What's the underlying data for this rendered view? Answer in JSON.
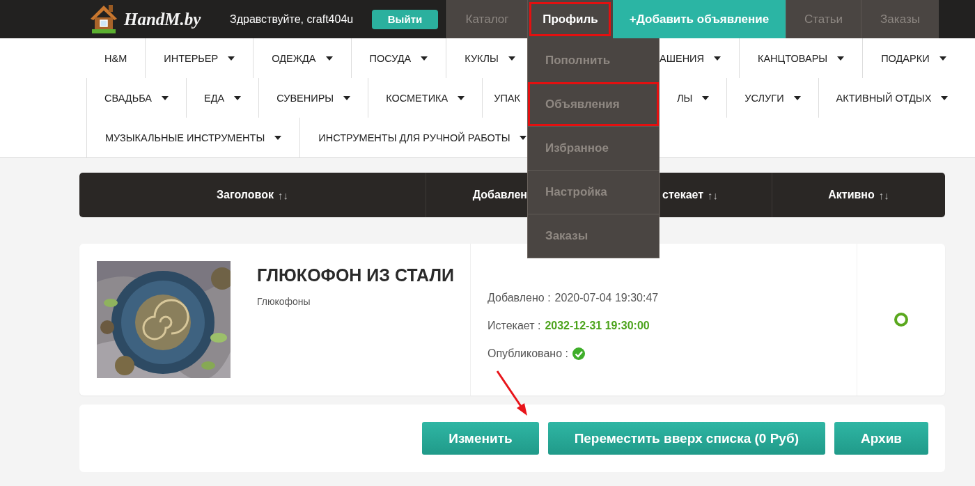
{
  "header": {
    "logo": "HandM.by",
    "greeting": "Здравствуйте, craft404u",
    "logout": "Выйти"
  },
  "nav": [
    {
      "label": "Каталог",
      "kind": "tab",
      "selected": false,
      "highlighted": false
    },
    {
      "label": "Профиль",
      "kind": "tab",
      "selected": true,
      "highlighted": true,
      "menu": [
        {
          "label": "Пополнить",
          "highlighted": false
        },
        {
          "label": "Объявления",
          "highlighted": true
        },
        {
          "label": "Избранное",
          "highlighted": false
        },
        {
          "label": "Настройка",
          "highlighted": false
        },
        {
          "label": "Заказы",
          "highlighted": false
        }
      ]
    },
    {
      "label": "+Добавить объявление",
      "kind": "accent"
    },
    {
      "label": "Статьи",
      "kind": "tab",
      "selected": false,
      "highlighted": false
    },
    {
      "label": "Заказы",
      "kind": "tab",
      "selected": false,
      "highlighted": false
    }
  ],
  "categories": [
    {
      "left": [
        {
          "label": "H&M",
          "dropdown": false
        },
        {
          "label": "ИНТЕРЬЕР",
          "dropdown": true
        },
        {
          "label": "ОДЕЖДА",
          "dropdown": true
        },
        {
          "label": "ПОСУДА",
          "dropdown": true
        },
        {
          "label": "КУКЛЫ",
          "dropdown": true
        }
      ],
      "right": [
        {
          "label": "АШЕНИЯ",
          "dropdown": true
        },
        {
          "label": "КАНЦТОВАРЫ",
          "dropdown": true
        },
        {
          "label": "ПОДАРКИ",
          "dropdown": true
        }
      ]
    },
    {
      "left": [
        {
          "label": "СВАДЬБА",
          "dropdown": true
        },
        {
          "label": "ЕДА",
          "dropdown": true
        },
        {
          "label": "СУВЕНИРЫ",
          "dropdown": true
        },
        {
          "label": "КОСМЕТИКА",
          "dropdown": true
        },
        {
          "label": "УПАК",
          "dropdown": false
        }
      ],
      "right": [
        {
          "label": "ЛЫ",
          "dropdown": true
        },
        {
          "label": "УСЛУГИ",
          "dropdown": true
        },
        {
          "label": "АКТИВНЫЙ ОТДЫХ",
          "dropdown": true
        }
      ]
    },
    {
      "left": [
        {
          "label": "МУЗЫКАЛЬНЫЕ ИНСТРУМЕНТЫ",
          "dropdown": true
        },
        {
          "label": "ИНСТРУМЕНТЫ ДЛЯ РУЧНОЙ РАБОТЫ",
          "dropdown": true
        }
      ]
    }
  ],
  "table_header": [
    {
      "label": "Заголовок",
      "sort": "↑↓"
    },
    {
      "label": "Добавлен"
    },
    {
      "label": "стекает",
      "sort": "↑↓"
    },
    {
      "label": "Активно",
      "sort": "↑↓"
    }
  ],
  "listing": {
    "title": "ГЛЮКОФОН ИЗ СТАЛИ",
    "category": "Глюкофоны",
    "details": [
      {
        "kind": "plain",
        "label": "Добавлено :",
        "value": "2020-07-04 19:30:47"
      },
      {
        "kind": "highlight",
        "label": "Истекает :",
        "value": "2032-12-31 19:30:00"
      },
      {
        "kind": "check",
        "label": "Опубликовано :",
        "published": true
      }
    ],
    "active": true
  },
  "actions": [
    {
      "label": "Изменить"
    },
    {
      "label": "Переместить вверх списка (0 Руб)"
    },
    {
      "label": "Архив"
    }
  ]
}
